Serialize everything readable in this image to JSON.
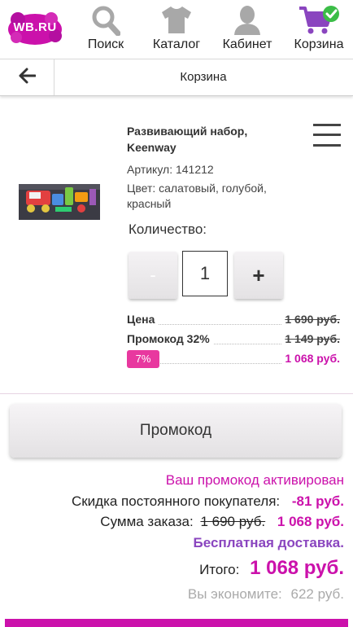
{
  "brand": {
    "logo_text": "WB.RU",
    "accent": "#cb11ab",
    "purple": "#8a45bf"
  },
  "nav": {
    "search": {
      "label": "Поиск",
      "icon": "search-icon"
    },
    "catalog": {
      "label": "Каталог",
      "icon": "tshirt-icon"
    },
    "account": {
      "label": "Кабинет",
      "icon": "person-icon"
    },
    "cart": {
      "label": "Корзина",
      "icon": "cart-icon"
    }
  },
  "page": {
    "title": "Корзина"
  },
  "product": {
    "name": "Развивающий набор, Keenway",
    "sku": "Артикул: 141212",
    "color": "Цвет: салатовый, голубой, красный",
    "quantity_label": "Количество:",
    "quantity": "1",
    "minus": "-",
    "plus": "+",
    "price_label": "Цена",
    "price_value": "1 690 руб.",
    "promo_label": "Промокод 32%",
    "promo_value": "1 149 руб.",
    "badge": "7%",
    "final_value": "1 068 руб."
  },
  "promo_button": "Промокод",
  "summary": {
    "activated": "Ваш промокод активирован",
    "discount_label": "Скидка постоянного покупателя:",
    "discount_value": "-81 руб.",
    "sum_label": "Сумма заказа:",
    "sum_old": "1 690 руб.",
    "sum_new": "1 068 руб.",
    "delivery": "Бесплатная доставка.",
    "total_label": "Итого:",
    "total_value": "1 068 руб.",
    "savings_label": "Вы экономите:",
    "savings_value": "622 руб."
  }
}
